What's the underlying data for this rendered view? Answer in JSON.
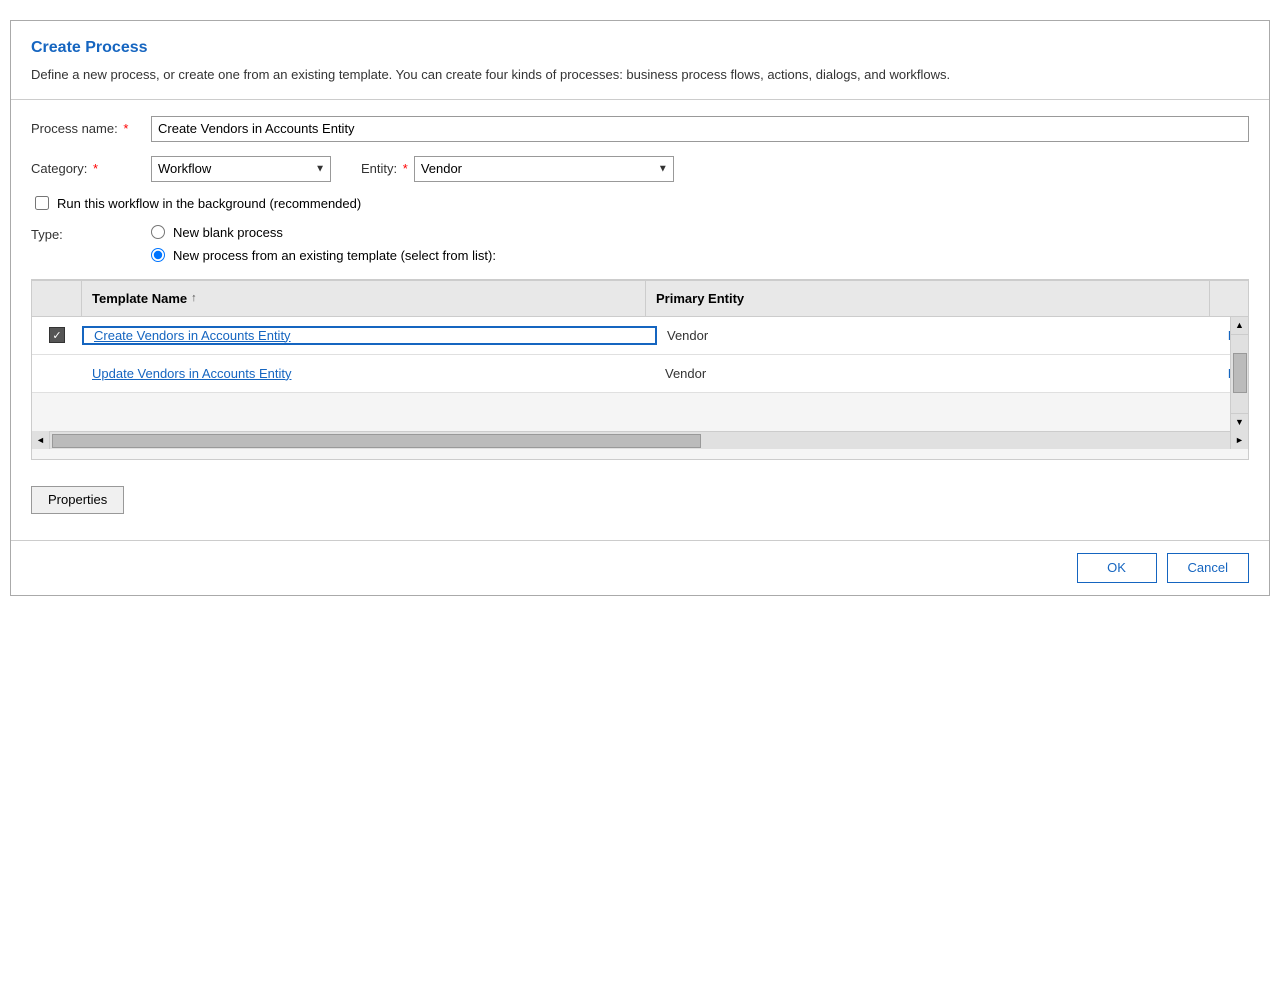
{
  "dialog": {
    "title": "Create Process",
    "description": "Define a new process, or create one from an existing template. You can create four kinds of processes: business process flows, actions, dialogs, and workflows.",
    "form": {
      "process_name_label": "Process name:",
      "process_name_value": "Create Vendors in Accounts Entity",
      "category_label": "Category:",
      "category_value": "Workflow",
      "entity_label": "Entity:",
      "entity_value": "Vendor",
      "checkbox_label": "Run this workflow in the background (recommended)",
      "type_label": "Type:",
      "radio_option1": "New blank process",
      "radio_option2": "New process from an existing template (select from list):"
    },
    "table": {
      "col_template_name": "Template Name",
      "col_primary_entity": "Primary Entity",
      "sort_indicator": "↑",
      "rows": [
        {
          "name": "Create Vendors in Accounts Entity",
          "entity": "Vendor",
          "extra": "Bi",
          "checked": true,
          "selected": true
        },
        {
          "name": "Update Vendors in Accounts Entity",
          "entity": "Vendor",
          "extra": "Bi",
          "checked": false,
          "selected": false
        }
      ]
    },
    "buttons": {
      "properties": "Properties",
      "ok": "OK",
      "cancel": "Cancel"
    }
  }
}
